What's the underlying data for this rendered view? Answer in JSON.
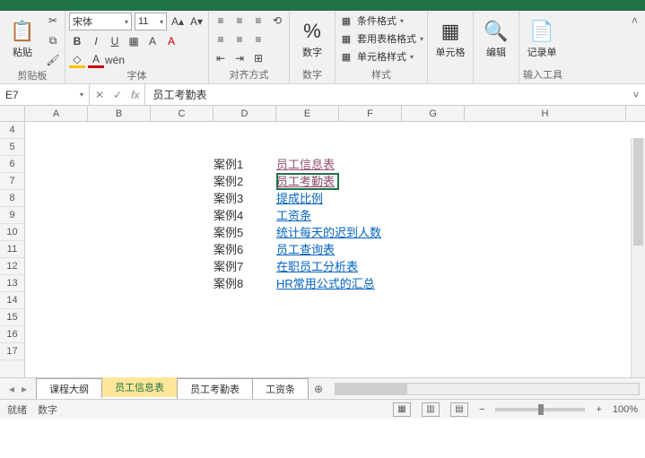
{
  "ribbon": {
    "clipboard": {
      "paste": "粘贴",
      "group": "剪贴板"
    },
    "font": {
      "name": "宋体",
      "size": "11",
      "bold": "B",
      "italic": "I",
      "underline": "U",
      "group": "字体",
      "phonetic": "wén"
    },
    "align": {
      "group": "对齐方式"
    },
    "number": {
      "btn": "数字",
      "group": "数字"
    },
    "styles": {
      "cond": "条件格式",
      "tablefmt": "套用表格格式",
      "cellfmt": "单元格样式",
      "group": "样式"
    },
    "cells": {
      "btn": "单元格"
    },
    "edit": {
      "btn": "编辑"
    },
    "form": {
      "btn": "记录单",
      "group": "输入工具"
    }
  },
  "formula": {
    "cellref": "E7",
    "value": "员工考勤表"
  },
  "columns": [
    "A",
    "B",
    "C",
    "D",
    "E",
    "F",
    "G",
    "H"
  ],
  "rows_start": 4,
  "rows": [
    "4",
    "5",
    "6",
    "7",
    "8",
    "9",
    "10",
    "11",
    "12",
    "13",
    "14",
    "15",
    "16",
    "17"
  ],
  "cases": [
    {
      "label": "案例1",
      "link": "员工信息表",
      "visited": true
    },
    {
      "label": "案例2",
      "link": "员工考勤表",
      "visited": true
    },
    {
      "label": "案例3",
      "link": "提成比例",
      "visited": false
    },
    {
      "label": "案例4",
      "link": "工资条",
      "visited": false
    },
    {
      "label": "案例5",
      "link": "统计每天的迟到人数",
      "visited": false
    },
    {
      "label": "案例6",
      "link": "员工查询表",
      "visited": false
    },
    {
      "label": "案例7",
      "link": "在职员工分析表",
      "visited": false
    },
    {
      "label": "案例8",
      "link": "HR常用公式的汇总",
      "visited": false
    }
  ],
  "sheets": {
    "tabs": [
      "课程大纲",
      "员工信息表",
      "员工考勤表",
      "工资条"
    ],
    "active_index": 1
  },
  "status": {
    "ready": "就绪",
    "num": "数字",
    "zoom": "100%"
  }
}
